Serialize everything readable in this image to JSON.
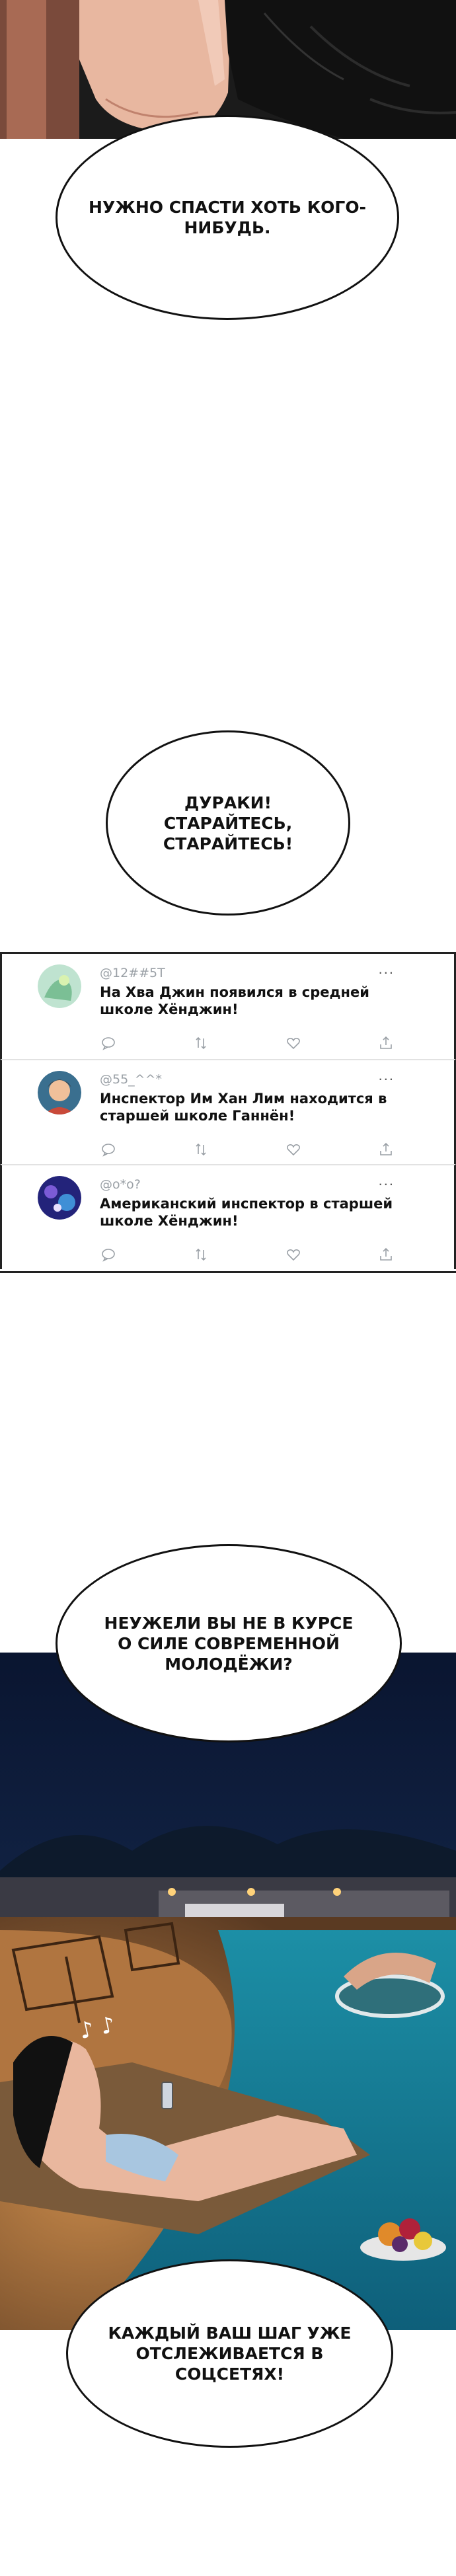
{
  "bubbles": {
    "b1": "НУЖНО СПАСТИ ХОТЬ КОГО-НИБУДЬ.",
    "b2": "ДУРАКИ! СТАРАЙТЕСЬ, СТАРАЙТЕСЬ!",
    "b3": "НЕУЖЕЛИ ВЫ НЕ В КУРСЕ О СИЛЕ СОВРЕМЕННОЙ МОЛОДЁЖИ?",
    "b4": "КАЖДЫЙ ВАШ ШАГ УЖЕ ОТСЛЕЖИВАЕТСЯ В СОЦСЕТЯХ!"
  },
  "feed": {
    "more_icon": "...",
    "posts": [
      {
        "handle": "@12##5T",
        "text": "На Хва Джин появился в средней школе Хёнджин!"
      },
      {
        "handle": "@55_^^*",
        "text": "Инспектор Им Хан Лим находится в старшей школе Ганнён!"
      },
      {
        "handle": "@o*o?",
        "text": "Американский инспектор в старшей школе Хёнджин!"
      }
    ]
  },
  "sfx": "♪ ♪"
}
